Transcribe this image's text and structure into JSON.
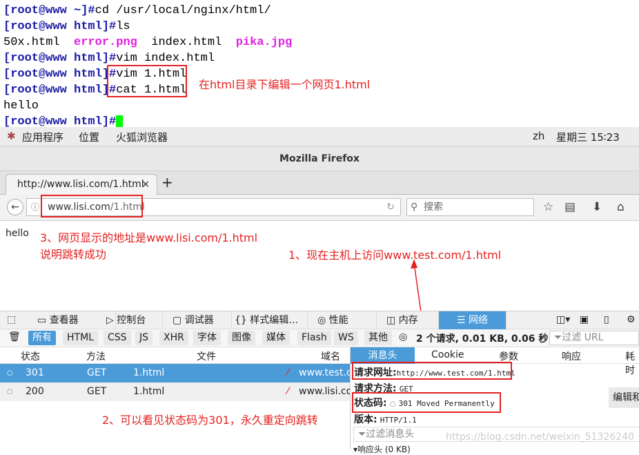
{
  "terminal": {
    "lines": [
      {
        "prompt": "[root@www ~]#",
        "cmd": "cd /usr/local/nginx/html/"
      },
      {
        "prompt": "[root@www html]#",
        "cmd": "ls"
      },
      {
        "files": [
          "50x.html",
          "error.png",
          "index.html",
          "pika.jpg"
        ]
      },
      {
        "prompt": "[root@www html]#",
        "cmd": "vim index.html"
      },
      {
        "prompt": "[root@www html]#",
        "cmd": "vim 1.html"
      },
      {
        "prompt": "[root@www html]#",
        "cmd": "cat 1.html"
      },
      {
        "output": "hello"
      },
      {
        "prompt": "[root@www html]#",
        "cmd": ""
      }
    ],
    "annotation": "在html目录下编辑一个网页1.html"
  },
  "desktop": {
    "menu": [
      "应用程序",
      "位置",
      "火狐浏览器"
    ],
    "lang": "zh",
    "clock": "星期三 15∶23"
  },
  "browser": {
    "title": "Mozilla Firefox",
    "tab": {
      "label": "http://www.lisi.com/1.html",
      "close": "×",
      "new": "+"
    },
    "url_host": "www.lisi.com",
    "url_path": "/1.html",
    "search_placeholder": "搜索",
    "page_text": "hello"
  },
  "annotations": {
    "a3_line1": "3、网页显示的地址是www.lisi.com/1.html",
    "a3_line2": "说明跳转成功",
    "a1": "1、现在主机上访问www.test.com/1.html",
    "a2": "2、可以看见状态码为301，永久重定向跳转"
  },
  "devtools": {
    "tabs": [
      "查看器",
      "控制台",
      "调试器",
      "样式编辑…",
      "性能",
      "内存",
      "网络"
    ],
    "active_tab": "网络",
    "filters": [
      "所有",
      "HTML",
      "CSS",
      "JS",
      "XHR",
      "字体",
      "图像",
      "媒体",
      "Flash",
      "WS",
      "其他"
    ],
    "summary": "2 个请求, 0.01 KB, 0.06 秒",
    "filter_url_placeholder": "过滤 URL",
    "columns": [
      "状态",
      "方法",
      "文件",
      "域名"
    ],
    "rows": [
      {
        "status": "301",
        "method": "GET",
        "file": "1.html",
        "domain": "www.test.c",
        "selected": true
      },
      {
        "status": "200",
        "method": "GET",
        "file": "1.html",
        "domain": "www.lisi.co",
        "selected": false
      }
    ],
    "detail_tabs": [
      "消息头",
      "Cookie",
      "参数",
      "响应",
      "耗时"
    ],
    "request_url_label": "请求网址:",
    "request_url": "http://www.test.com/1.html",
    "method_label": "请求方法:",
    "method": "GET",
    "status_label": "状态码:",
    "status": "301 Moved Permanently",
    "version_label": "版本:",
    "version": "HTTP/1.1",
    "edit_button": "编辑和",
    "filter_headers_placeholder": "过滤消息头",
    "response_headers": "响应头 (0 KB)",
    "accent": "#4a9bd8"
  },
  "watermark": "https://blog.csdn.net/weixin_51326240"
}
